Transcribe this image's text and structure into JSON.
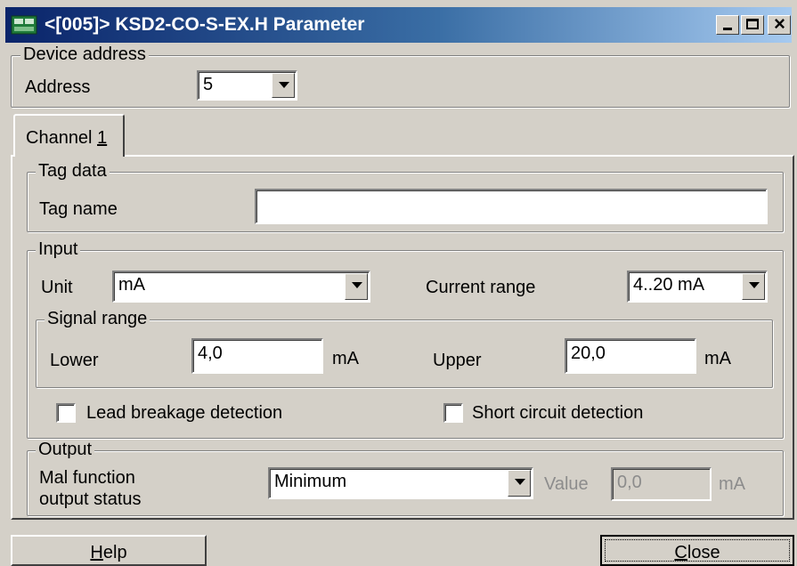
{
  "window": {
    "title": "<[005]> KSD2-CO-S-EX.H Parameter",
    "icon": "device-app-icon",
    "controls": [
      "minimize-icon",
      "maximize-icon",
      "close-icon"
    ]
  },
  "device_address": {
    "group_label": "Device address",
    "address_label": "Address",
    "address_value": "5"
  },
  "tabs": [
    {
      "label_prefix": "Channel ",
      "label_accel": "1"
    }
  ],
  "tag_data": {
    "group_label": "Tag data",
    "tag_name_label": "Tag name",
    "tag_name_value": ""
  },
  "input": {
    "group_label": "Input",
    "unit_label": "Unit",
    "unit_value": "mA",
    "current_range_label": "Current range",
    "current_range_value": "4..20 mA",
    "signal_range": {
      "group_label": "Signal range",
      "lower_label": "Lower",
      "lower_value": "4,0",
      "lower_unit": "mA",
      "upper_label": "Upper",
      "upper_value": "20,0",
      "upper_unit": "mA"
    },
    "lead_breakage_label": "Lead breakage detection",
    "lead_breakage_checked": false,
    "short_circuit_label": "Short circuit detection",
    "short_circuit_checked": false
  },
  "output": {
    "group_label": "Output",
    "malfunction_label_line1": "Mal function",
    "malfunction_label_line2": "output status",
    "malfunction_value": "Minimum",
    "value_label": "Value",
    "value_value": "0,0",
    "value_unit": "mA"
  },
  "buttons": {
    "help_accel": "H",
    "help_rest": "elp",
    "close_accel": "C",
    "close_rest": "lose"
  },
  "colors": {
    "face": "#d4d0c8",
    "title_start": "#0a246a",
    "title_end": "#a6caf0",
    "disabled_text": "#8c8c8c"
  }
}
